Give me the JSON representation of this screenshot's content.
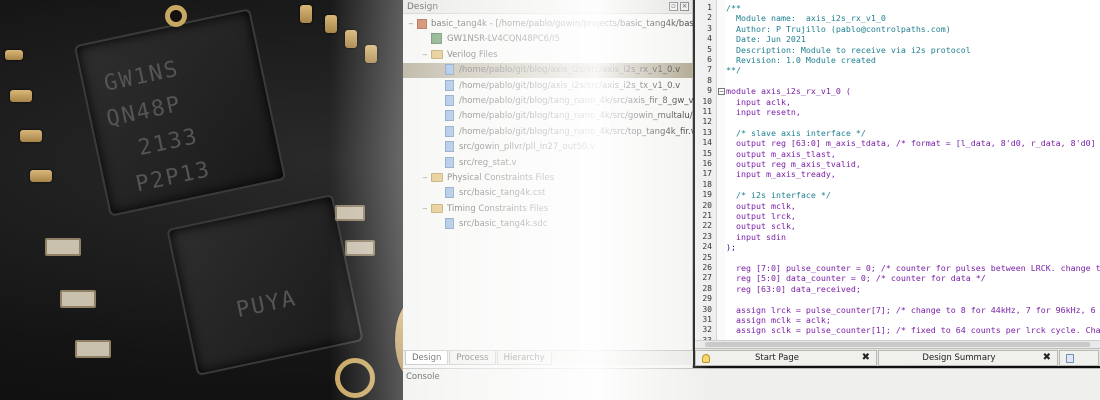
{
  "design_panel": {
    "title": "Design",
    "tree": [
      {
        "label": "basic_tang4k - [/home/pablo/gowin/projects/basic_tang4k/basic_tan...",
        "type": "project",
        "indent": 0,
        "expand": "−"
      },
      {
        "label": "GW1NSR-LV4CQN48PC6/I5",
        "type": "chip",
        "indent": 1
      },
      {
        "label": "Verilog Files",
        "type": "folder",
        "indent": 1,
        "expand": "−"
      },
      {
        "label": "/home/pablo/git/blog/axis_i2s/src/axis_i2s_rx_v1_0.v",
        "type": "file",
        "indent": 2,
        "selected": true
      },
      {
        "label": "/home/pablo/git/blog/axis_i2s/src/axis_i2s_tx_v1_0.v",
        "type": "file",
        "indent": 2
      },
      {
        "label": "/home/pablo/git/blog/tang_nano_4k/src/axis_fir_8_gw_v1_0.v",
        "type": "file",
        "indent": 2
      },
      {
        "label": "/home/pablo/git/blog/tang_nano_4k/src/gowin_multalu/macc.v",
        "type": "file",
        "indent": 2
      },
      {
        "label": "/home/pablo/git/blog/tang_nano_4k/src/top_tang4k_fir.v",
        "type": "file",
        "indent": 2
      },
      {
        "label": "src/gowin_pllvr/pll_in27_out50.v",
        "type": "file",
        "indent": 2
      },
      {
        "label": "src/reg_stat.v",
        "type": "file",
        "indent": 2
      },
      {
        "label": "Physical Constraints Files",
        "type": "folder",
        "indent": 1,
        "expand": "−"
      },
      {
        "label": "src/basic_tang4k.cst",
        "type": "file",
        "indent": 2
      },
      {
        "label": "Timing Constraints Files",
        "type": "folder",
        "indent": 1,
        "expand": "−"
      },
      {
        "label": "src/basic_tang4k.sdc",
        "type": "file",
        "indent": 2
      }
    ],
    "tabs": [
      "Design",
      "Process",
      "Hierarchy"
    ]
  },
  "console": {
    "label": "Console"
  },
  "editor": {
    "lines": [
      {
        "n": "1",
        "text": "/**",
        "cls": "comment"
      },
      {
        "n": "2",
        "text": "  Module name:  axis_i2s_rx_v1_0",
        "cls": "comment"
      },
      {
        "n": "3",
        "text": "  Author: P Trujillo (pablo@controlpaths.com)",
        "cls": "comment"
      },
      {
        "n": "4",
        "text": "  Date: Jun 2021",
        "cls": "comment"
      },
      {
        "n": "5",
        "text": "  Description: Module to receive via i2s protocol",
        "cls": "comment"
      },
      {
        "n": "6",
        "text": "  Revision: 1.0 Module created",
        "cls": "comment"
      },
      {
        "n": "7",
        "text": "**/",
        "cls": "comment"
      },
      {
        "n": "8",
        "text": "",
        "cls": "plain"
      },
      {
        "n": "9",
        "text": "module axis_i2s_rx_v1_0 (",
        "cls": "kw"
      },
      {
        "n": "10",
        "text": "  input aclk,",
        "cls": "kw"
      },
      {
        "n": "11",
        "text": "  input resetn,",
        "cls": "kw"
      },
      {
        "n": "12",
        "text": "",
        "cls": "plain"
      },
      {
        "n": "13",
        "text": "  /* slave axis interface */",
        "cls": "comment"
      },
      {
        "n": "14",
        "text": "  output reg [63:0] m_axis_tdata, /* format = [l_data, 8'd0, r_data, 8'd0] */",
        "cls": "kw"
      },
      {
        "n": "15",
        "text": "  output m_axis_tlast,",
        "cls": "kw"
      },
      {
        "n": "16",
        "text": "  output reg m_axis_tvalid,",
        "cls": "kw"
      },
      {
        "n": "17",
        "text": "  input m_axis_tready,",
        "cls": "kw"
      },
      {
        "n": "18",
        "text": "",
        "cls": "plain"
      },
      {
        "n": "19",
        "text": "  /* i2s interface */",
        "cls": "comment"
      },
      {
        "n": "20",
        "text": "  output mclk,",
        "cls": "kw"
      },
      {
        "n": "21",
        "text": "  output lrck,",
        "cls": "kw"
      },
      {
        "n": "22",
        "text": "  output sclk,",
        "cls": "kw"
      },
      {
        "n": "23",
        "text": "  input sdin",
        "cls": "kw"
      },
      {
        "n": "24",
        "text": ");",
        "cls": "plain"
      },
      {
        "n": "25",
        "text": "",
        "cls": "plain"
      },
      {
        "n": "26",
        "text": "  reg [7:0] pulse_counter = 0; /* counter for pulses between LRCK. change to 9",
        "cls": "kw"
      },
      {
        "n": "27",
        "text": "  reg [5:0] data_counter = 0; /* counter for data */",
        "cls": "kw"
      },
      {
        "n": "28",
        "text": "  reg [63:0] data_received;",
        "cls": "kw"
      },
      {
        "n": "29",
        "text": "",
        "cls": "plain"
      },
      {
        "n": "30",
        "text": "  assign lrck = pulse_counter[7]; /* change to 8 for 44kHz, 7 for 96kHz, 6 for",
        "cls": "kw"
      },
      {
        "n": "31",
        "text": "  assign mclk = aclk;",
        "cls": "kw"
      },
      {
        "n": "32",
        "text": "  assign sclk = pulse_counter[1]; /* fixed to 64 counts per lrck cycle. Change",
        "cls": "kw"
      },
      {
        "n": "33",
        "text": "",
        "cls": "plain"
      }
    ]
  },
  "doc_tabs": [
    {
      "label": "Start Page",
      "close": "✖"
    },
    {
      "label": "Design Summary",
      "close": "✖"
    }
  ],
  "photo": {
    "chip1_text": [
      "GW1NS",
      "QN48P",
      "2133",
      "P2P13"
    ],
    "chip2_text": [
      "PUYA"
    ]
  }
}
